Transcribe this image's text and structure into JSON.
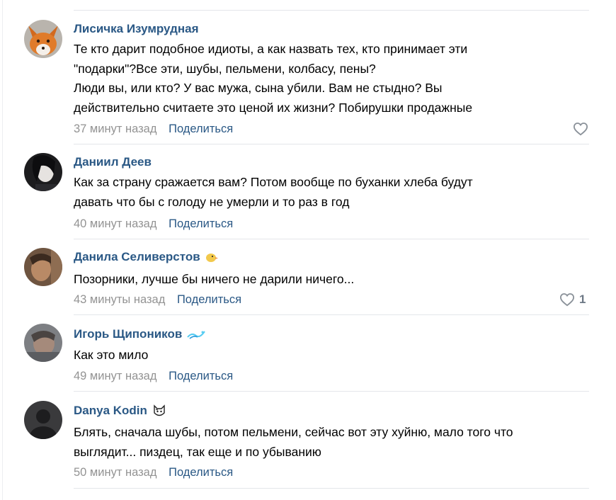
{
  "comments": [
    {
      "author": "Лисичка Изумрудная",
      "text": "Те кто дарит подобное идиоты, а как назвать тех, кто принимает эти\n\"подарки\"?Все эти, шубы, пельмени, колбасу, пены?\nЛюди вы, или кто? У вас мужа, сына убили. Вам не стыдно? Вы\nдействительно считаете это ценой их жизни? Побирушки продажные",
      "time": "37 минут назад",
      "share": "Поделиться",
      "likes": ""
    },
    {
      "author": "Даниил Деев",
      "text": "Как за страну сражается вам? Потом вообще по буханки хлеба будут\nдавать что бы с голоду не умерли и то раз в год",
      "time": "40 минут назад",
      "share": "Поделиться"
    },
    {
      "author": "Данила Селиверстов",
      "text": "Позорники, лучше бы ничего не дарили ничего...",
      "time": "43 минуты назад",
      "share": "Поделиться",
      "likes": "1"
    },
    {
      "author": "Игорь Щипоников",
      "text": "Как это мило",
      "time": "49 минут назад",
      "share": "Поделиться"
    },
    {
      "author": "Danya Kodin",
      "text": "Блять, сначала шубы, потом пельмени, сейчас вот эту хуйню, мало того что\nвыглядит... пиздец, так еще и по убыванию",
      "time": "50 минут назад",
      "share": "Поделиться"
    }
  ],
  "icons": {
    "like": "heart-outline-icon",
    "badge_2": "duck-emoji-icon",
    "badge_3": "wave-emoji-icon",
    "badge_4": "cat-emoji-icon"
  },
  "colors": {
    "author": "#2a5885",
    "link": "#2a5885",
    "meta": "#939393",
    "separator": "#e4e6ea"
  }
}
